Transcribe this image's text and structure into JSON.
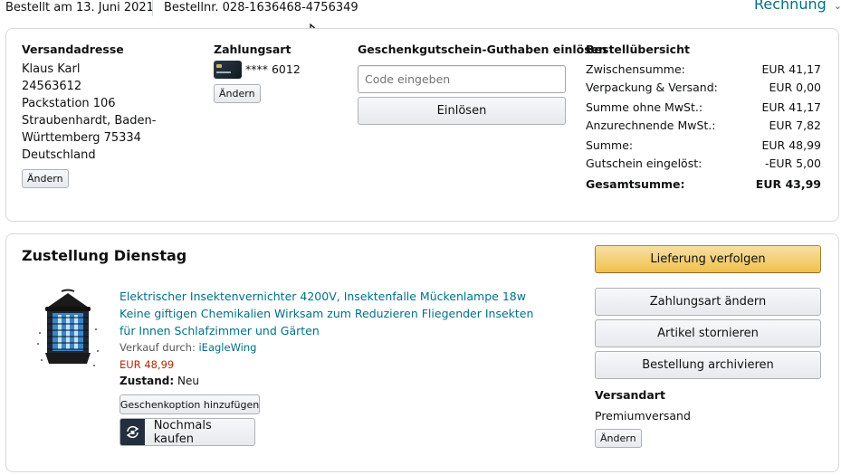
{
  "header": {
    "order_date": "Bestellt am 13. Juni 2021",
    "order_number": "Bestellnr. 028-1636468-4756349",
    "invoice_label": "Rechnung"
  },
  "shipping": {
    "heading": "Versandadresse",
    "lines": [
      "Klaus Karl",
      "24563612",
      "Packstation 106",
      "Straubenhardt, Baden-",
      "Württemberg 75334",
      "Deutschland"
    ],
    "change_label": "Ändern"
  },
  "payment": {
    "heading": "Zahlungsart",
    "card": "**** 6012",
    "change_label": "Ändern"
  },
  "gift": {
    "heading": "Geschenkgutschein-Guthaben einlösen",
    "placeholder": "Code eingeben",
    "redeem_label": "Einlösen"
  },
  "summary": {
    "heading": "Bestellübersicht",
    "rows": [
      {
        "label": "Zwischensumme:",
        "value": "EUR 41,17"
      },
      {
        "label": "Verpackung & Versand:",
        "value": "EUR 0,00"
      },
      {
        "label": "Summe ohne MwSt.:",
        "value": "EUR 41,17"
      },
      {
        "label": "Anzurechnende MwSt.:",
        "value": "EUR 7,82"
      },
      {
        "label": "Summe:",
        "value": "EUR 48,99"
      },
      {
        "label": "Gutschein eingelöst:",
        "value": "-EUR 5,00"
      }
    ],
    "total_label": "Gesamtsumme:",
    "total_value": "EUR 43,99"
  },
  "delivery": {
    "heading": "Zustellung Dienstag",
    "product": {
      "title": "Elektrischer Insektenvernichter 4200V, Insektenfalle Mückenlampe 18w Keine giftigen Chemikalien Wirksam zum Reduzieren Fliegender Insekten für Innen Schlafzimmer und Gärten",
      "seller_prefix": "Verkauf durch:",
      "seller": "iEagleWing",
      "price": "EUR 48,99",
      "condition_label": "Zustand:",
      "condition_value": "Neu",
      "gift_option_label": "Geschenkoption hinzufügen",
      "buy_again_label": "Nochmals kaufen"
    },
    "actions": {
      "track": "Lieferung verfolgen",
      "change_payment": "Zahlungsart ändern",
      "cancel": "Artikel stornieren",
      "archive": "Bestellung archivieren"
    },
    "shipping_method": {
      "heading": "Versandart",
      "value": "Premiumversand",
      "change_label": "Ändern"
    }
  },
  "colors": {
    "link": "#007185",
    "price": "#b12704",
    "primary_button": "#f0c14b",
    "border": "#d5d9d9"
  }
}
